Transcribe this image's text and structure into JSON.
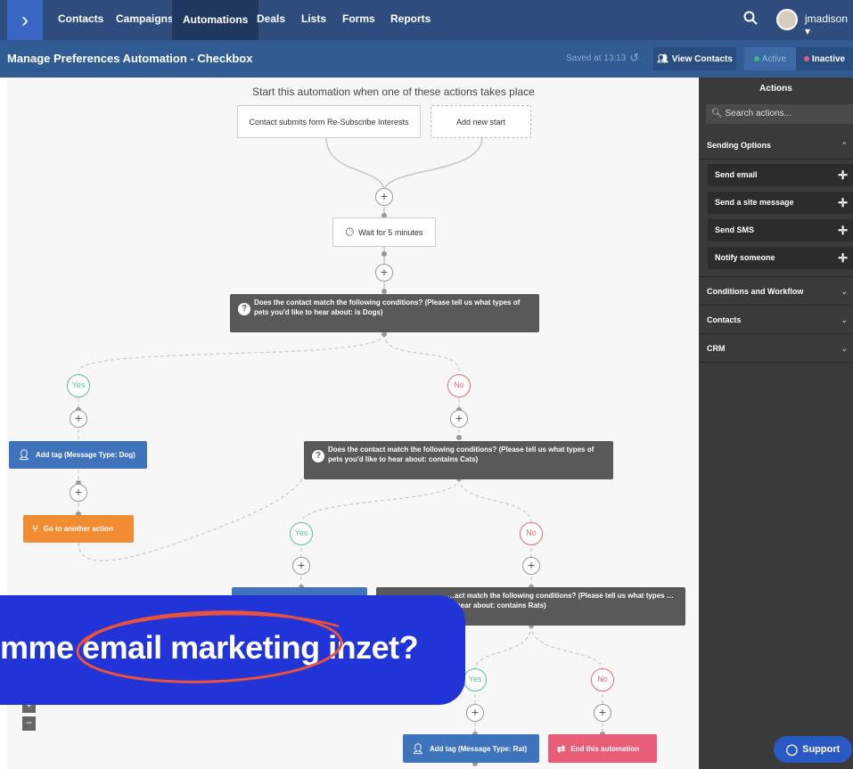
{
  "nav": {
    "items": [
      {
        "label": "Contacts"
      },
      {
        "label": "Campaigns"
      },
      {
        "label": "Automations"
      },
      {
        "label": "Deals"
      },
      {
        "label": "Lists"
      },
      {
        "label": "Forms"
      },
      {
        "label": "Reports"
      }
    ],
    "active": "Automations",
    "username": "jmadison"
  },
  "header": {
    "title": "Manage Preferences Automation - Checkbox",
    "saved": "Saved at 13:13",
    "view_contacts": "View Contacts",
    "active_label": "Active",
    "inactive_label": "Inactive"
  },
  "sidebar": {
    "title": "Actions",
    "search_placeholder": "Search actions...",
    "sections": [
      {
        "label": "Sending Options",
        "expanded": true,
        "items": [
          "Send email",
          "Send a site message",
          "Send SMS",
          "Notify someone"
        ]
      },
      {
        "label": "Conditions and Workflow",
        "expanded": false
      },
      {
        "label": "Contacts",
        "expanded": false
      },
      {
        "label": "CRM",
        "expanded": false
      }
    ]
  },
  "flow": {
    "heading": "Start this automation when one of these actions takes place",
    "start_trigger": "Contact submits form Re-Subscribe Interests",
    "add_start": "Add new start",
    "wait": "Wait for 5 minutes",
    "cond1": "Does the contact match the following conditions? (Please tell us what types of pets you'd like to hear about: is Dogs)",
    "cond2": "Does the contact match the following conditions? (Please tell us what types of pets you'd like to hear about: contains Cats)",
    "cond3": "…act match the following conditions? (Please tell us what types …to hear about: contains Rats)",
    "yes": "Yes",
    "no": "No",
    "add_tag_dog": "Add tag (Message Type: Dog)",
    "go_to_action": "Go to another action",
    "add_tag_rat": "Add tag (Message Type: Rat)",
    "end_automation": "End this automation"
  },
  "banner": {
    "text": "mme email marketing inzet?",
    "circle_color": "#e8533a",
    "bg_color": "#2134d8"
  },
  "support_label": "Support",
  "colors": {
    "nav_bg": "#2e4d7e",
    "subbar_bg": "#315c93",
    "yes": "#5cc28a",
    "no": "#e06c6c",
    "tag_blue": "#3f74bd",
    "goto_orange": "#f08d32",
    "end_pink": "#e85d78"
  }
}
